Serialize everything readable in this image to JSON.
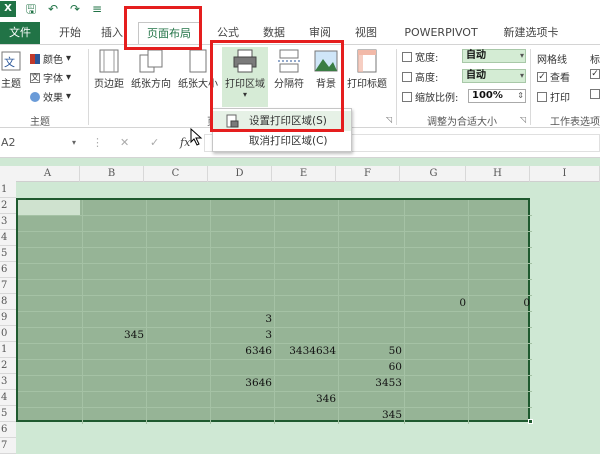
{
  "qat": {
    "save_icon": "save-icon",
    "undo_icon": "undo-icon",
    "redo_icon": "redo-icon",
    "more": "≡"
  },
  "tabs": {
    "file": "文件",
    "home": "开始",
    "insert": "插入",
    "page_layout": "页面布局",
    "formulas": "公式",
    "data": "数据",
    "review": "审阅",
    "view": "视图",
    "powerpivot": "POWERPIVOT",
    "new_tab": "新建选项卡"
  },
  "ribbon": {
    "theme_group": {
      "themes_label": "主题",
      "colors": "颜色",
      "fonts": "字体",
      "effects": "效果",
      "group_label": "主题"
    },
    "page_setup": {
      "margins": "页边距",
      "orientation": "纸张方向",
      "size": "纸张大小",
      "print_area": "打印区域",
      "breaks": "分隔符",
      "background": "背景",
      "print_titles": "打印标题",
      "group_label_partial": "页"
    },
    "scale": {
      "width_label": "宽度:",
      "width_value": "自动",
      "height_label": "高度:",
      "height_value": "自动",
      "scale_label": "缩放比例:",
      "scale_value": "100%",
      "group_label": "调整为合适大小"
    },
    "sheet_options": {
      "gridlines": "网格线",
      "view": "查看",
      "print": "打印",
      "headings_partial": "标",
      "group_label": "工作表选项"
    }
  },
  "dropdown": {
    "set_print_area": "设置打印区域(S)",
    "clear_print_area": "取消打印区域(C)"
  },
  "formula_bar": {
    "name_box": "A2",
    "cancel": "✕",
    "enter": "✓",
    "fx": "fx"
  },
  "columns": [
    "A",
    "B",
    "C",
    "D",
    "E",
    "F",
    "G",
    "H",
    "I"
  ],
  "rows": [
    "1",
    "2",
    "3",
    "4",
    "5",
    "6",
    "7",
    "8",
    "9",
    "0",
    "1",
    "2",
    "3",
    "4",
    "5",
    "6",
    "7"
  ],
  "cells": {
    "H8": "0",
    "I8": "0",
    "E9": "3",
    "C10": "345",
    "E10": "3",
    "E11": "6346",
    "F11": "3434634",
    "G11": "50",
    "G12": "60",
    "E13": "3646",
    "G13": "3453",
    "F14": "346",
    "G15": "345"
  }
}
